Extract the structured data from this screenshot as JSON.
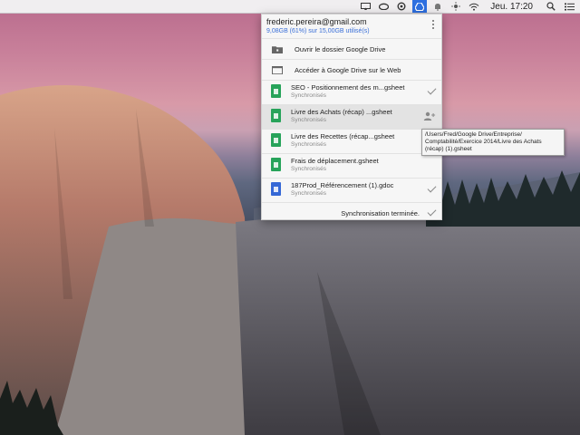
{
  "menubar": {
    "clock": "Jeu. 17:20",
    "icons": [
      "screen-mirroring-icon",
      "creative-cloud-icon",
      "sync-icon",
      "google-drive-icon",
      "notifications-icon",
      "flux-icon",
      "wifi-icon",
      "spotlight-icon",
      "notification-center-icon"
    ]
  },
  "drive": {
    "account": "frederic.pereira@gmail.com",
    "quota": "9,08GB (61%) sur 15,00GB utilisé(s)",
    "actions": [
      {
        "label": "Ouvrir le dossier Google Drive",
        "icon": "folder-icon"
      },
      {
        "label": "Accéder à Google Drive sur le Web",
        "icon": "web-icon"
      }
    ],
    "files": [
      {
        "name": "SEO - Positionnement des m...gsheet",
        "status": "Synchronisés"
      },
      {
        "name": "Livre des Achats (récap) ...gsheet",
        "status": "Synchronisés"
      },
      {
        "name": "Livre des Recettes (récap...gsheet",
        "status": "Synchronisés"
      },
      {
        "name": "Frais de déplacement.gsheet",
        "status": "Synchronisés"
      },
      {
        "name": "187Prod_Référencement (1).gdoc",
        "status": "Synchronisés"
      }
    ],
    "footer": "Synchronisation terminée."
  },
  "tooltip": {
    "line1": "/Users/Fred/Google Drive/Entreprise/",
    "line2": "Comptabilité/Exercice 2014/Livre des Achats",
    "line3": "(récap) (1).gsheet"
  },
  "colors": {
    "accent": "#2d6fe0",
    "quota": "#3a6fd8",
    "sheet": "#27a35a",
    "doc": "#3568d6"
  }
}
